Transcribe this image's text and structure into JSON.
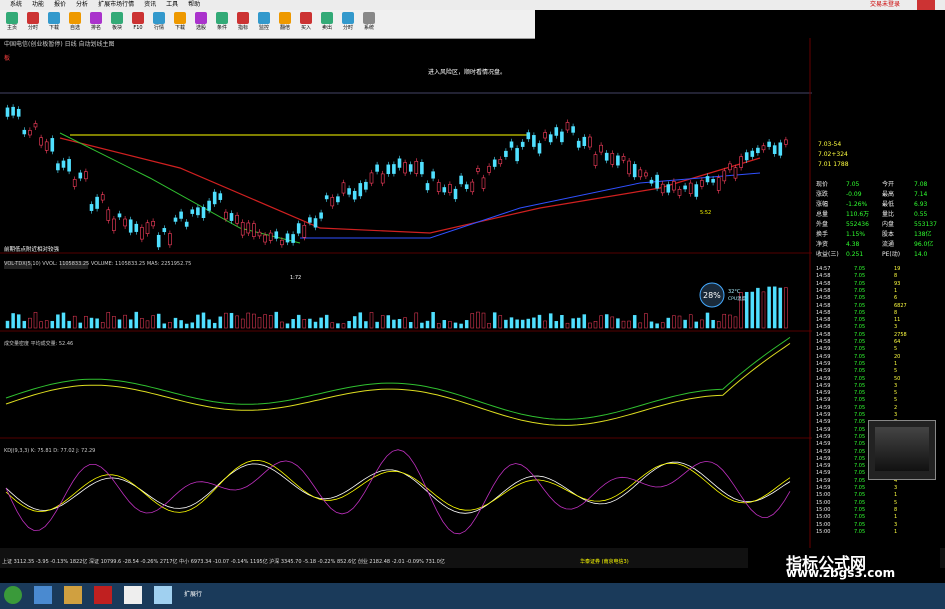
{
  "menu": [
    "系统",
    "功能",
    "报价",
    "分析",
    "扩展市场行情",
    "资讯",
    "工具",
    "帮助"
  ],
  "menu_right": "交易未登录",
  "toolbar": [
    "主页",
    "分时",
    "下载",
    "自选",
    "排名",
    "板块",
    "F10",
    "行情",
    "下载",
    "选股",
    "条件",
    "指标",
    "监控",
    "翻倍",
    "买入",
    "卖出",
    "分时",
    "系统"
  ],
  "stock_title": "中国电信(创业板暂停) 日线 自动划线主图",
  "chart_notes": {
    "top_right": "进入风险区，顺时看情况盘。",
    "mid_left": "前期低点附近相对较强",
    "low_mark": "1:72",
    "low_right": "5:52"
  },
  "cpu": {
    "pct": "28%",
    "temp": "32°C",
    "label": "CPU温度"
  },
  "vol_title": "VOL-TDX(5,10) VVOL: 1105833.25  VOLUME: 1105833.25  MA5: 2251952.75",
  "ind_title": "成交量密度 平均成交量: 52.46",
  "kdj_title": "KDJ(9,3,3) K: 75.81 D: 77.02 J: 72.29",
  "quote_top": [
    "7.03-54",
    "7.02+324",
    "7.01   1788"
  ],
  "quote_rows": [
    {
      "k": "现价",
      "v": "7.05",
      "k2": "今开",
      "v2": "7.08"
    },
    {
      "k": "涨跌",
      "v": "-0.09",
      "k2": "最高",
      "v2": "7.14"
    },
    {
      "k": "涨幅",
      "v": "-1.26%",
      "k2": "最低",
      "v2": "6.93"
    },
    {
      "k": "总量",
      "v": "110.6万",
      "k2": "量比",
      "v2": "0.55"
    },
    {
      "k": "外盘",
      "v": "552436",
      "k2": "内盘",
      "v2": "553137"
    },
    {
      "k": "换手",
      "v": "1.15%",
      "k2": "股本",
      "v2": "138亿"
    },
    {
      "k": "净资",
      "v": "4.38",
      "k2": "流通",
      "v2": "96.0亿"
    },
    {
      "k": "收益(三)",
      "v": "0.251",
      "k2": "PE(动)",
      "v2": "14.0"
    }
  ],
  "ticks": [
    {
      "t": "14:57",
      "p": "7.05",
      "v": "19"
    },
    {
      "t": "14:58",
      "p": "7.05",
      "v": "8"
    },
    {
      "t": "14:58",
      "p": "7.05",
      "v": "93"
    },
    {
      "t": "14:58",
      "p": "7.05",
      "v": "1"
    },
    {
      "t": "14:58",
      "p": "7.05",
      "v": "6"
    },
    {
      "t": "14:58",
      "p": "7.05",
      "v": "6827"
    },
    {
      "t": "14:58",
      "p": "7.05",
      "v": "8"
    },
    {
      "t": "14:58",
      "p": "7.05",
      "v": "11"
    },
    {
      "t": "14:58",
      "p": "7.05",
      "v": "3"
    },
    {
      "t": "14:58",
      "p": "7.05",
      "v": "2758"
    },
    {
      "t": "14:58",
      "p": "7.05",
      "v": "64"
    },
    {
      "t": "14:59",
      "p": "7.05",
      "v": "5"
    },
    {
      "t": "14:59",
      "p": "7.05",
      "v": "20"
    },
    {
      "t": "14:59",
      "p": "7.05",
      "v": "1"
    },
    {
      "t": "14:59",
      "p": "7.05",
      "v": "5"
    },
    {
      "t": "14:59",
      "p": "7.05",
      "v": "50"
    },
    {
      "t": "14:59",
      "p": "7.05",
      "v": "3"
    },
    {
      "t": "14:59",
      "p": "7.05",
      "v": "5"
    },
    {
      "t": "14:59",
      "p": "7.05",
      "v": "5"
    },
    {
      "t": "14:59",
      "p": "7.05",
      "v": "2"
    },
    {
      "t": "14:59",
      "p": "7.05",
      "v": "3"
    },
    {
      "t": "14:59",
      "p": "7.05",
      "v": "9"
    },
    {
      "t": "14:59",
      "p": "7.05",
      "v": "3"
    },
    {
      "t": "14:59",
      "p": "7.05",
      "v": "1"
    },
    {
      "t": "14:59",
      "p": "7.05",
      "v": "4"
    },
    {
      "t": "14:59",
      "p": "7.05",
      "v": "9"
    },
    {
      "t": "14:59",
      "p": "7.05",
      "v": "1"
    },
    {
      "t": "14:59",
      "p": "7.05",
      "v": "5"
    },
    {
      "t": "14:59",
      "p": "7.05",
      "v": "1"
    },
    {
      "t": "14:59",
      "p": "7.05",
      "v": "4"
    },
    {
      "t": "14:59",
      "p": "7.05",
      "v": "3"
    },
    {
      "t": "15:00",
      "p": "7.05",
      "v": "1"
    },
    {
      "t": "15:00",
      "p": "7.05",
      "v": "5"
    },
    {
      "t": "15:00",
      "p": "7.05",
      "v": "8"
    },
    {
      "t": "15:00",
      "p": "7.05",
      "v": "1"
    },
    {
      "t": "15:00",
      "p": "7.05",
      "v": "3"
    },
    {
      "t": "15:00",
      "p": "7.05",
      "v": "1"
    },
    {
      "t": "15:00",
      "p": "7.05",
      "v": "4"
    }
  ],
  "bottom_tabs": [
    "指标",
    "模板",
    "常用",
    "风格化",
    "顺势分类",
    "技术分析",
    "中线",
    "短线",
    "日线",
    "60分",
    "周线",
    "月线",
    "大盘",
    "个股",
    "成交",
    "财务",
    "成长",
    "选股",
    "自选",
    "板块",
    "指数"
  ],
  "status": "上证 3112.35 -3.95 -0.13% 1822亿  深证 10799.6 -28.54 -0.26% 2717亿  中小 6973.34 -10.07 -0.14% 1195亿  沪深 3345.70 -5.18 -0.22% 852.6亿  创业 2182.48 -2.01 -0.09% 731.0亿",
  "status_right": "华泰证券 (南京电信3)",
  "watermark": {
    "title": "指标公式网",
    "url": "www.zbgs3.com"
  },
  "taskbar_label": "扩展行"
}
